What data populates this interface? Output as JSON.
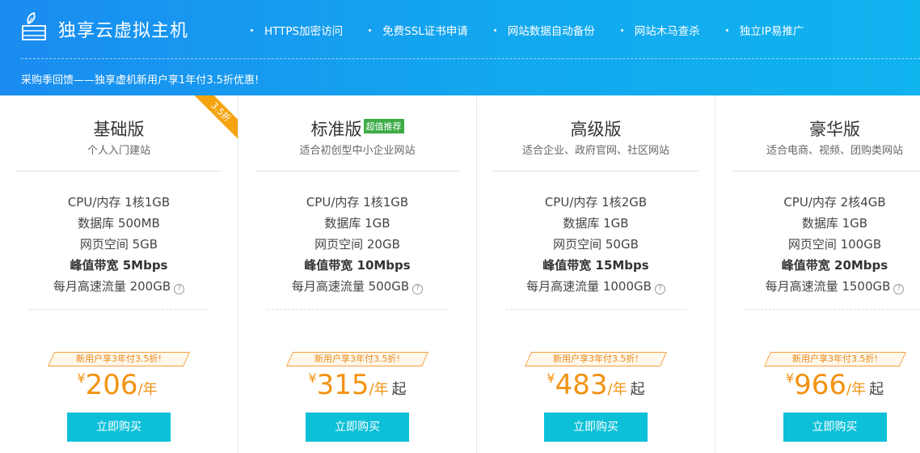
{
  "header": {
    "brand": "独享云虚拟主机",
    "features": [
      "HTTPS加密访问",
      "免费SSL证书申请",
      "网站数据自动备份",
      "网站木马查杀",
      "独立IP易推广"
    ],
    "promo": "采购季回馈——独享虚机新用户享1年付3.5折优惠!"
  },
  "plans": [
    {
      "name": "基础版",
      "tag": "",
      "ribbon": "3.5折",
      "subtitle": "个人入门建站",
      "specs": [
        "CPU/内存 1核1GB",
        "数据库 500MB",
        "网页空间 5GB",
        "峰值带宽 5Mbps",
        "每月高速流量 200GB"
      ],
      "deal": "新用户享3年付3.5折!",
      "currency": "¥",
      "price": "206",
      "unit": "/年",
      "suffix": "",
      "buy_label": "立即购买"
    },
    {
      "name": "标准版",
      "tag": "超值推荐",
      "ribbon": "",
      "subtitle": "适合初创型中小企业网站",
      "specs": [
        "CPU/内存 1核1GB",
        "数据库 1GB",
        "网页空间 20GB",
        "峰值带宽 10Mbps",
        "每月高速流量 500GB"
      ],
      "deal": "新用户享3年付3.5折!",
      "currency": "¥",
      "price": "315",
      "unit": "/年",
      "suffix": "起",
      "buy_label": "立即购买"
    },
    {
      "name": "高级版",
      "tag": "",
      "ribbon": "",
      "subtitle": "适合企业、政府官网、社区网站",
      "specs": [
        "CPU/内存 1核2GB",
        "数据库 1GB",
        "网页空间 50GB",
        "峰值带宽 15Mbps",
        "每月高速流量 1000GB"
      ],
      "deal": "新用户享3年付3.5折!",
      "currency": "¥",
      "price": "483",
      "unit": "/年",
      "suffix": "起",
      "buy_label": "立即购买"
    },
    {
      "name": "豪华版",
      "tag": "",
      "ribbon": "",
      "subtitle": "适合电商、视频、团购类网站",
      "specs": [
        "CPU/内存 2核4GB",
        "数据库 1GB",
        "网页空间 100GB",
        "峰值带宽 20Mbps",
        "每月高速流量 1500GB"
      ],
      "deal": "新用户享3年付3.5折!",
      "currency": "¥",
      "price": "966",
      "unit": "/年",
      "suffix": "起",
      "buy_label": "立即购买"
    }
  ],
  "help_icon_glyph": "?",
  "colors": {
    "banner_start": "#1a8cf0",
    "banner_end": "#0fb3ee",
    "price": "#f39211",
    "buy_button": "#0cc0d8",
    "tag": "#3dab45",
    "ribbon": "#f5a40e"
  }
}
